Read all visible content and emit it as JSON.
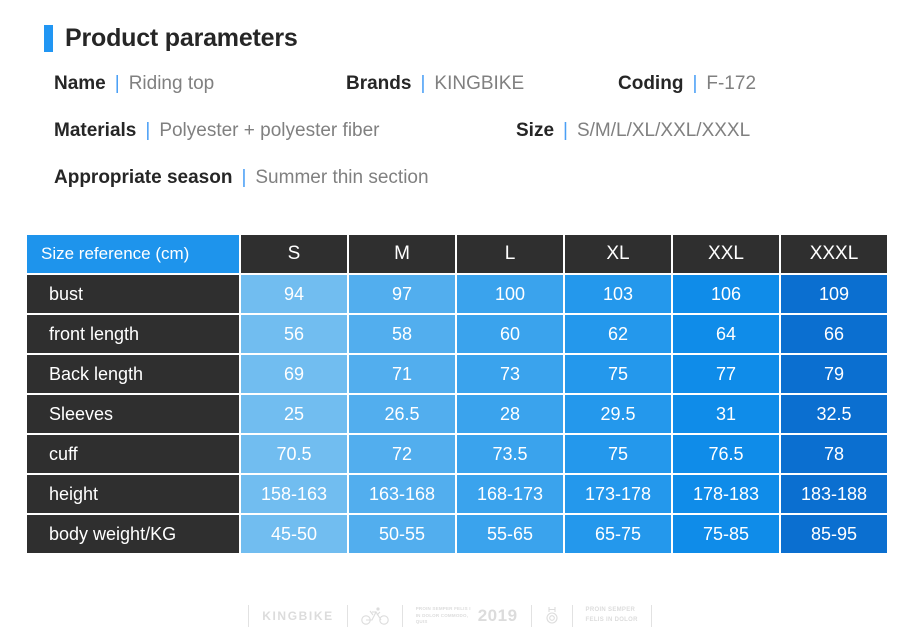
{
  "header": {
    "title": "Product parameters",
    "accent_color": "#2196f3"
  },
  "specs": {
    "separator": "|",
    "rows": [
      [
        {
          "key": "Name",
          "value": "Riding top"
        },
        {
          "key": "Brands",
          "value": "KINGBIKE"
        },
        {
          "key": "Coding",
          "value": "F-172"
        }
      ],
      [
        {
          "key": "Materials",
          "value": "Polyester + polyester fiber"
        },
        {
          "key": "Size",
          "value": "S/M/L/XL/XXL/XXXL"
        }
      ],
      [
        {
          "key": "Appropriate season",
          "value": "Summer thin section"
        }
      ]
    ]
  },
  "table": {
    "corner_label": "Size reference (cm)",
    "columns": [
      "S",
      "M",
      "L",
      "XL",
      "XXL",
      "XXXL"
    ],
    "column_colors": [
      "#71bdf0",
      "#52aeee",
      "#3aa3ed",
      "#2498ec",
      "#0f8ce9",
      "#0b6fd0"
    ],
    "header_bg": "#2f2f2f",
    "corner_bg": "#1e94ec",
    "rows": [
      {
        "label": "bust",
        "values": [
          "94",
          "97",
          "100",
          "103",
          "106",
          "109"
        ]
      },
      {
        "label": "front length",
        "values": [
          "56",
          "58",
          "60",
          "62",
          "64",
          "66"
        ]
      },
      {
        "label": "Back length",
        "values": [
          "69",
          "71",
          "73",
          "75",
          "77",
          "79"
        ]
      },
      {
        "label": "Sleeves",
        "values": [
          "25",
          "26.5",
          "28",
          "29.5",
          "31",
          "32.5"
        ]
      },
      {
        "label": "cuff",
        "values": [
          "70.5",
          "72",
          "73.5",
          "75",
          "76.5",
          "78"
        ]
      },
      {
        "label": "height",
        "values": [
          "158-163",
          "163-168",
          "168-173",
          "173-178",
          "178-183",
          "183-188"
        ]
      },
      {
        "label": "body weight/KG",
        "values": [
          "45-50",
          "50-55",
          "55-65",
          "65-75",
          "75-85",
          "85-95"
        ]
      }
    ]
  },
  "footer": {
    "brand": "KINGBIKE",
    "micro_text_1": "PROIN SEMPER FELIS I",
    "micro_text_2": "IN DOLOR COMMODO, QUIS",
    "year": "2019",
    "motto_line1": "PROIN SEMPER",
    "motto_line2": "FELIS IN DOLOR"
  }
}
